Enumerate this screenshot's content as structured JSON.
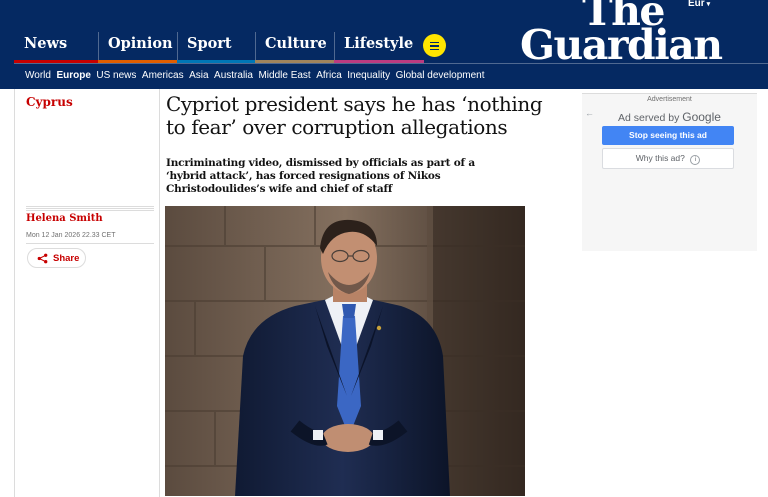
{
  "header": {
    "edition": "Eur",
    "logo_line1": "The",
    "logo_line2": "Guardian",
    "pillars": [
      {
        "label": "News",
        "color": "#c70000"
      },
      {
        "label": "Opinion",
        "color": "#e05e00"
      },
      {
        "label": "Sport",
        "color": "#0077b6"
      },
      {
        "label": "Culture",
        "color": "#a1845c"
      },
      {
        "label": "Lifestyle",
        "color": "#bb3b80"
      }
    ],
    "subnav": [
      "World",
      "Europe",
      "US news",
      "Americas",
      "Asia",
      "Australia",
      "Middle East",
      "Africa",
      "Inequality",
      "Global development"
    ],
    "subnav_active": "Europe"
  },
  "article": {
    "section": "Cyprus",
    "headline": "Cypriot president says he has ‘nothing to fear’ over corruption allegations",
    "standfirst": "Incriminating video, dismissed by officials as part of a ‘hybrid attack’, has forced resignations of Nikos Christodoulides’s wife and chief of staff",
    "byline": "Helena Smith",
    "dateline": "Mon 12 Jan 2026 22.33 CET",
    "share_label": "Share"
  },
  "ad": {
    "label": "Advertisement",
    "served_prefix": "Ad served by",
    "served_brand": "Google",
    "stop_label": "Stop seeing this ad",
    "why_label": "Why this ad?"
  },
  "icons": {
    "menu": "hamburger-icon",
    "share": "share-icon",
    "info": "info-icon",
    "back": "back-arrow-icon"
  },
  "colors": {
    "brand_navy": "#052962",
    "news_red": "#c70000",
    "menu_yellow": "#ffe500",
    "ad_blue": "#4285f4"
  }
}
